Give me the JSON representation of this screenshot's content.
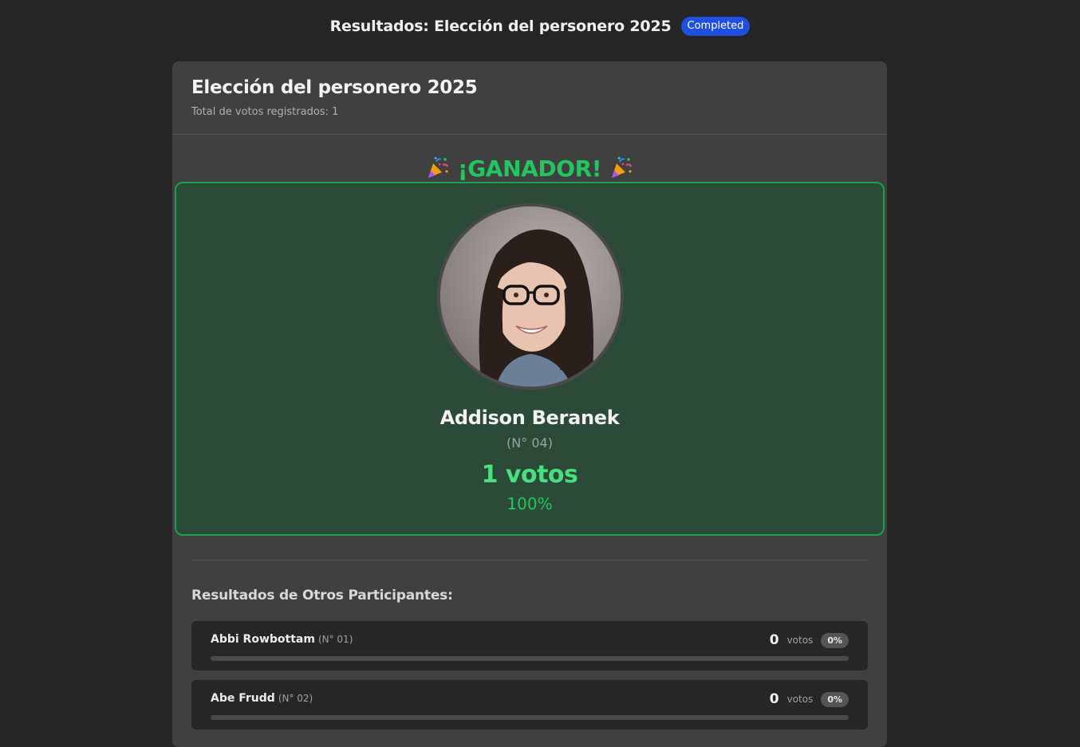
{
  "topbar": {
    "title": "Resultados: Elección del personero 2025",
    "status": "Completed"
  },
  "election": {
    "title": "Elección del personero 2025",
    "total_votes_text": "Total de votos registrados: 1"
  },
  "winner": {
    "heading": "¡GANADOR!",
    "name": "Addison Beranek",
    "number": "(N° 04)",
    "votes": "1 votos",
    "percent": "100%",
    "share": 1.0
  },
  "others": {
    "title": "Resultados de Otros Participantes:",
    "vote_label": "votos",
    "participants": [
      {
        "name": "Abbi Rowbottam",
        "number": "(N° 01)",
        "votes": "0",
        "percent": "0%",
        "share": 0
      },
      {
        "name": "Abe Frudd",
        "number": "(N° 02)",
        "votes": "0",
        "percent": "0%",
        "share": 0
      }
    ]
  },
  "colors": {
    "background": "#252525",
    "card": "#404040",
    "accent_green": "#22c55e",
    "badge_blue": "#1f4fe0"
  },
  "icons": {
    "party": "party-popper-icon"
  }
}
